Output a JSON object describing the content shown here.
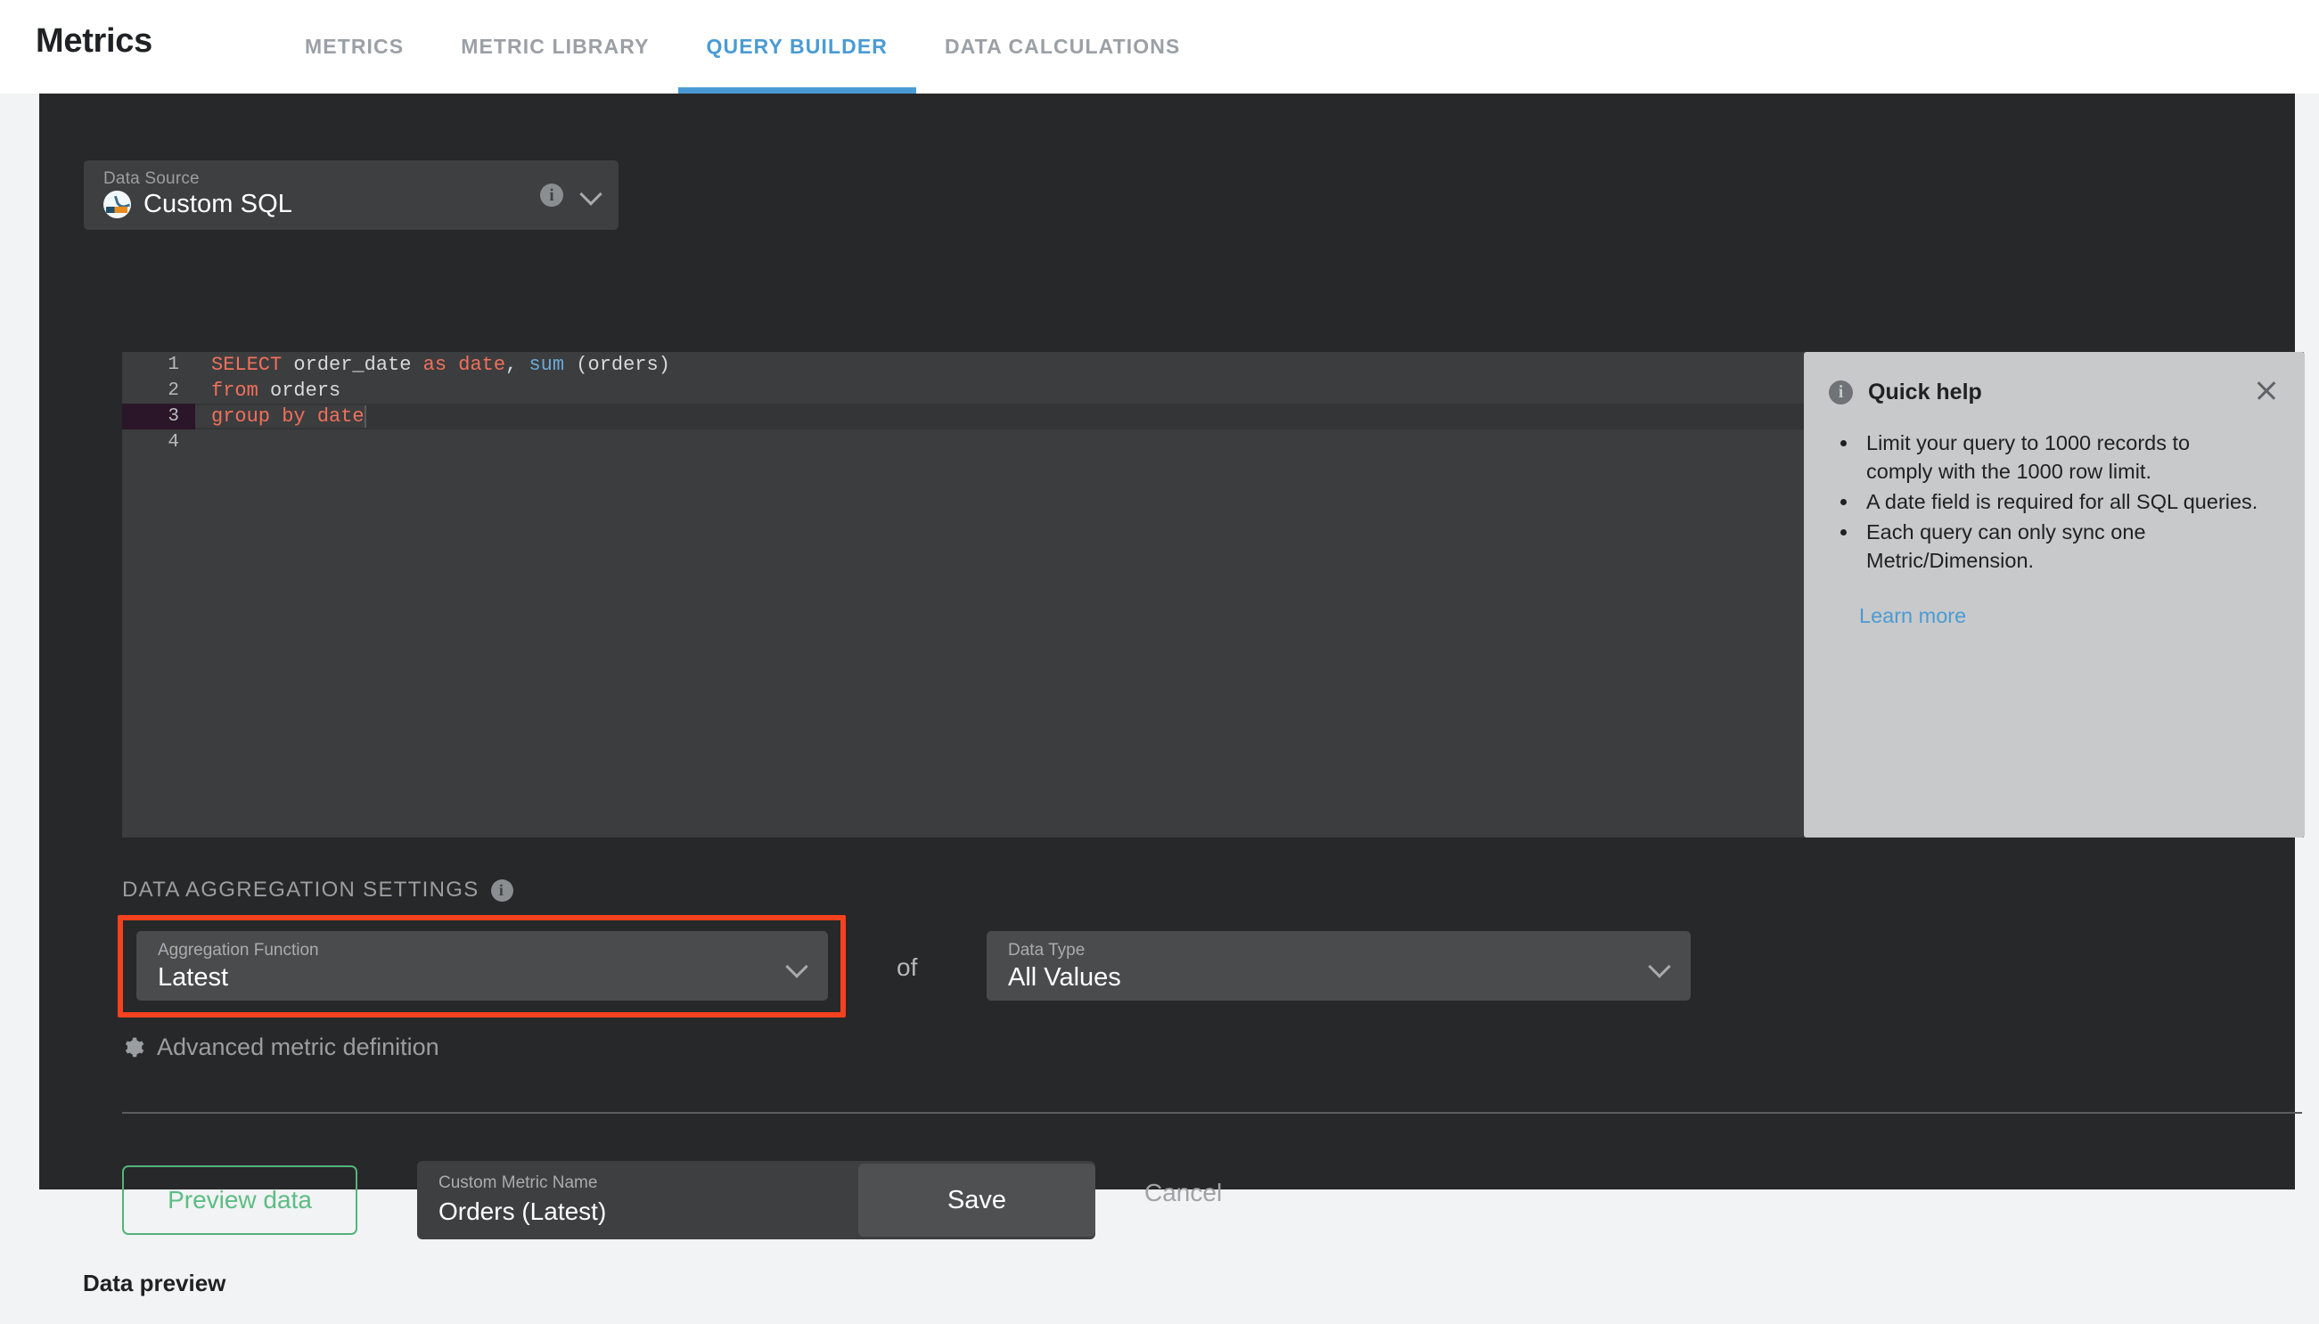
{
  "header": {
    "app_title": "Metrics",
    "tabs": [
      {
        "label": "METRICS",
        "active": false
      },
      {
        "label": "METRIC LIBRARY",
        "active": false
      },
      {
        "label": "QUERY BUILDER",
        "active": true
      },
      {
        "label": "DATA CALCULATIONS",
        "active": false
      }
    ]
  },
  "data_source": {
    "label": "Data Source",
    "value": "Custom SQL",
    "icon": "mysql-logo-icon",
    "info_icon": "info-icon",
    "chevron_icon": "chevron-down-icon"
  },
  "editor": {
    "lines": [
      {
        "number": "1",
        "active": false
      },
      {
        "number": "2",
        "active": false
      },
      {
        "number": "3",
        "active": true
      },
      {
        "number": "4",
        "active": false
      }
    ],
    "line1_kw1": "SELECT",
    "line1_t1": " order_date ",
    "line1_kw2": "as",
    "line1_t2": " ",
    "line1_kw3": "date",
    "line1_t3": ", ",
    "line1_fn": "sum",
    "line1_t4": " (orders)",
    "line2_kw": "from",
    "line2_t": " orders",
    "line3_kw": "group by date",
    "line4_t": ""
  },
  "quick_help": {
    "title": "Quick help",
    "info_icon": "info-icon",
    "close_icon": "close-icon",
    "bullets": [
      "Limit your query to 1000 records to comply with the 1000 row limit.",
      "A date field is required for all SQL queries.",
      "Each query can only sync one Metric/Dimension."
    ],
    "link": "Learn more"
  },
  "aggregation": {
    "section_title": "DATA AGGREGATION SETTINGS",
    "section_info_icon": "info-icon",
    "function_label": "Aggregation Function",
    "function_value": "Latest",
    "of_word": "of",
    "data_type_label": "Data Type",
    "data_type_value": "All Values",
    "highlight_color": "#f4411e",
    "advanced_label": "Advanced metric definition",
    "advanced_icon": "gear-icon"
  },
  "footer": {
    "preview_label": "Preview data",
    "metric_name_label": "Custom Metric Name",
    "metric_name_value": "Orders (Latest)",
    "save_label": "Save",
    "cancel_label": "Cancel"
  },
  "page": {
    "data_preview_title": "Data preview",
    "accent_color": "#4a9bd4",
    "panel_bg": "#272829"
  }
}
